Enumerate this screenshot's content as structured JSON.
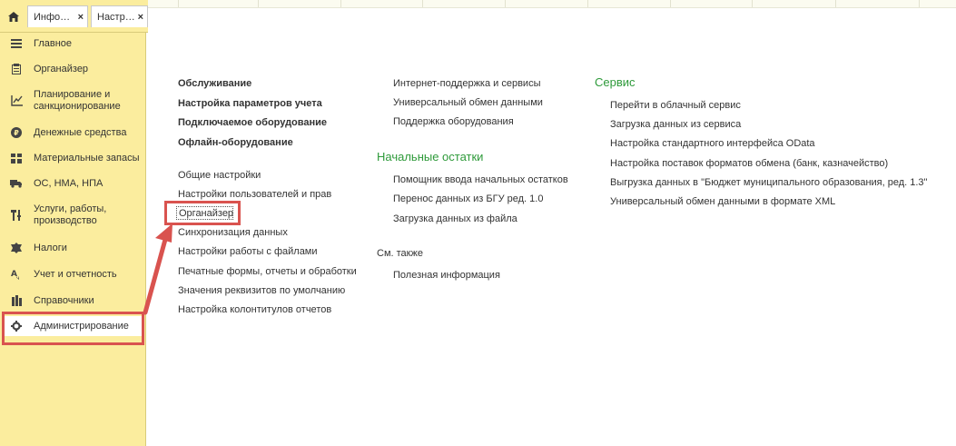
{
  "tabs": [
    {
      "label": "Инфо…",
      "close": "×"
    },
    {
      "label": "Настр…",
      "close": "×"
    }
  ],
  "sidebar": {
    "items": [
      {
        "label": "Главное",
        "icon": "menu-lines-icon"
      },
      {
        "label": "Органайзер",
        "icon": "notepad-icon"
      },
      {
        "label": "Планирование и санкционирование",
        "icon": "planning-icon"
      },
      {
        "label": "Денежные средства",
        "icon": "coin-icon"
      },
      {
        "label": "Материальные запасы",
        "icon": "grid-icon"
      },
      {
        "label": "ОС, НМА, НПА",
        "icon": "truck-icon"
      },
      {
        "label": "Услуги, работы, производство",
        "icon": "tools-icon"
      },
      {
        "label": "Налоги",
        "icon": "emblem-icon"
      },
      {
        "label": "Учет и отчетность",
        "icon": "accounting-icon"
      },
      {
        "label": "Справочники",
        "icon": "books-icon"
      },
      {
        "label": "Администрирование",
        "icon": "gear-icon"
      }
    ],
    "active_index": 10
  },
  "main": {
    "column1": {
      "bold_links": [
        "Обслуживание",
        "Настройка параметров учета",
        "Подключаемое оборудование",
        "Офлайн-оборудование"
      ],
      "links": [
        "Общие настройки",
        "Настройки пользователей и прав",
        "Органайзер",
        "Синхронизация данных",
        "Настройки работы с файлами",
        "Печатные формы, отчеты и обработки",
        "Значения реквизитов по умолчанию",
        "Настройка колонтитулов отчетов"
      ]
    },
    "column2": {
      "links_top": [
        "Интернет-поддержка и сервисы",
        "Универсальный обмен данными",
        "Поддержка оборудования"
      ],
      "heading": "Начальные остатки",
      "links_mid": [
        "Помощник ввода начальных остатков",
        "Перенос данных из БГУ ред. 1.0",
        "Загрузка данных из файла"
      ],
      "see_also": "См. также",
      "links_bottom": [
        "Полезная информация"
      ]
    },
    "column3": {
      "heading": "Сервис",
      "links": [
        "Перейти в облачный сервис",
        "Загрузка данных из сервиса",
        "Настройка стандартного интерфейса OData",
        "Настройка поставок форматов обмена (банк, казначейство)",
        "Выгрузка данных в \"Бюджет муниципального образования, ред. 1.3\"",
        "Универсальный обмен данными в формате XML"
      ]
    }
  },
  "colors": {
    "sidebar_bg": "#fbed9e",
    "heading_green": "#2e9a3a",
    "highlight_red": "#d9534f"
  }
}
